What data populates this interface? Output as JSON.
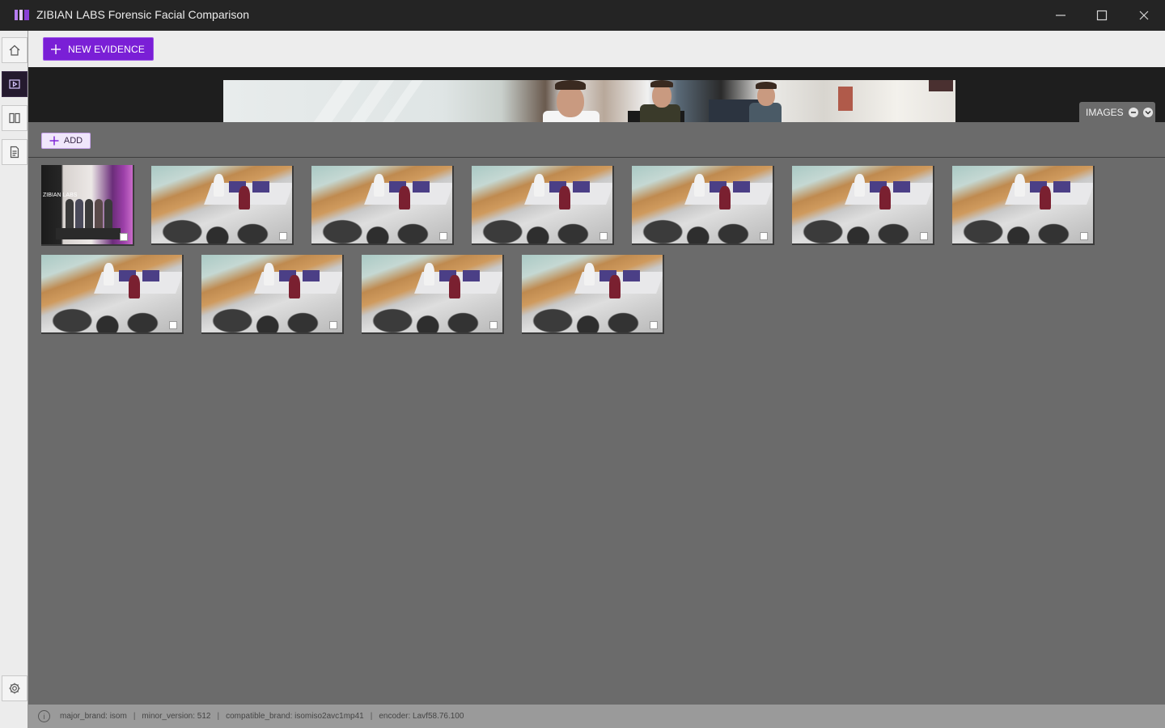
{
  "window": {
    "title": "ZIBIAN LABS Forensic Facial Comparison"
  },
  "toolbar": {
    "new_evidence_label": "NEW EVIDENCE"
  },
  "preview": {
    "tab_label": "IMAGES"
  },
  "gallery": {
    "add_label": "ADD",
    "thumbnails": 11,
    "booth_sign": "ZIBIAN LABS"
  },
  "statusbar": {
    "info_glyph": "i",
    "major_brand": "major_brand: isom",
    "minor_version": "minor_version: 512",
    "compatible_brand": "compatible_brand: isomiso2avc1mp41",
    "encoder": "encoder: Lavf58.76.100",
    "separator": "|"
  },
  "icons": {
    "nav": [
      "home-icon",
      "video-evidence-icon",
      "compare-columns-icon",
      "document-icon",
      "settings-icon"
    ]
  },
  "colors": {
    "accent": "#7a1fd6",
    "titlebar": "#242424",
    "workspace": "#6b6b6b"
  }
}
